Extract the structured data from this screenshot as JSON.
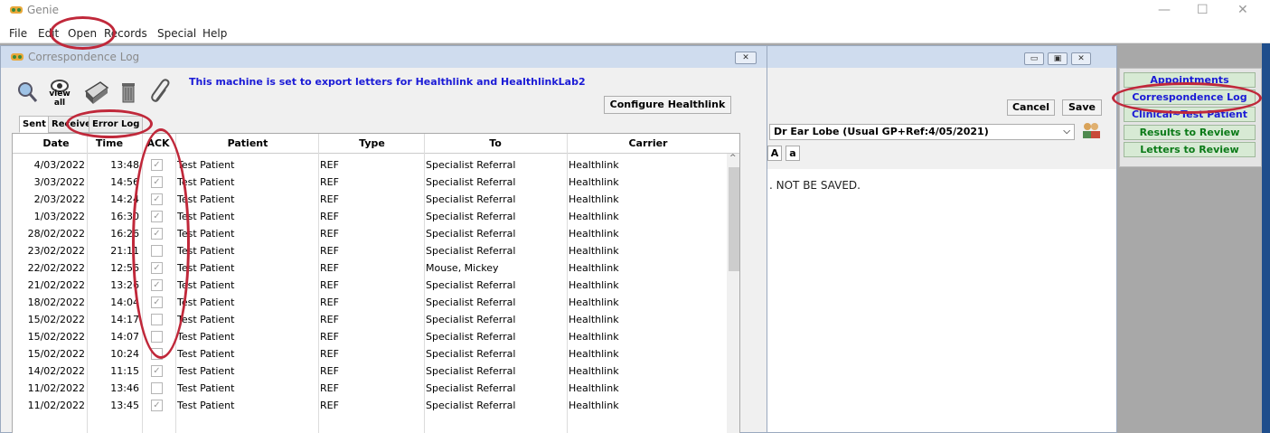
{
  "app": {
    "title": "Genie"
  },
  "menu": [
    "File",
    "Edit",
    "Open",
    "Records",
    "Special",
    "Help"
  ],
  "right_panel": {
    "buttons": [
      {
        "label": "Appointments",
        "color": "#1a1ad6"
      },
      {
        "label": "Correspondence Log",
        "color": "#1a1ad6"
      },
      {
        "label": "Clinical~Test Patient",
        "color": "#1a1ad6"
      },
      {
        "label": "Results to Review",
        "color": "#0b7a18"
      },
      {
        "label": "Letters to Review",
        "color": "#0b7a18"
      }
    ]
  },
  "back_window": {
    "cancel_label": "Cancel",
    "save_label": "Save",
    "doctor_combo_value": "Dr Ear Lobe (Usual GP+Ref:4/05/2021)",
    "text_buttons": [
      "A",
      "a"
    ],
    "warning_text": ". NOT BE SAVED."
  },
  "correspondence_log": {
    "title": "Correspondence Log",
    "toolbar": {
      "view_all_label": "view all"
    },
    "export_message": "This machine is set to export letters for Healthlink and HealthlinkLab2",
    "configure_button": "Configure Healthlink",
    "tabs": [
      "Sent",
      "Received",
      "Error Log"
    ],
    "columns": [
      "Date",
      "Time",
      "ACK",
      "Patient",
      "Type",
      "To",
      "Carrier"
    ],
    "rows": [
      {
        "date": "4/03/2022",
        "time": "13:48",
        "ack": true,
        "patient": "Test Patient",
        "type": "REF",
        "to": "Specialist Referral",
        "carrier": "Healthlink"
      },
      {
        "date": "3/03/2022",
        "time": "14:56",
        "ack": true,
        "patient": "Test Patient",
        "type": "REF",
        "to": "Specialist Referral",
        "carrier": "Healthlink"
      },
      {
        "date": "2/03/2022",
        "time": "14:24",
        "ack": true,
        "patient": "Test Patient",
        "type": "REF",
        "to": "Specialist Referral",
        "carrier": "Healthlink"
      },
      {
        "date": "1/03/2022",
        "time": "16:30",
        "ack": true,
        "patient": "Test Patient",
        "type": "REF",
        "to": "Specialist Referral",
        "carrier": "Healthlink"
      },
      {
        "date": "28/02/2022",
        "time": "16:26",
        "ack": true,
        "patient": "Test Patient",
        "type": "REF",
        "to": "Specialist Referral",
        "carrier": "Healthlink"
      },
      {
        "date": "23/02/2022",
        "time": "21:11",
        "ack": false,
        "patient": "Test Patient",
        "type": "REF",
        "to": "Specialist Referral",
        "carrier": "Healthlink"
      },
      {
        "date": "22/02/2022",
        "time": "12:56",
        "ack": true,
        "patient": "Test Patient",
        "type": "REF",
        "to": "Mouse, Mickey",
        "carrier": "Healthlink"
      },
      {
        "date": "21/02/2022",
        "time": "13:26",
        "ack": true,
        "patient": "Test Patient",
        "type": "REF",
        "to": "Specialist Referral",
        "carrier": "Healthlink"
      },
      {
        "date": "18/02/2022",
        "time": "14:04",
        "ack": true,
        "patient": "Test Patient",
        "type": "REF",
        "to": "Specialist Referral",
        "carrier": "Healthlink"
      },
      {
        "date": "15/02/2022",
        "time": "14:17",
        "ack": false,
        "patient": "Test Patient",
        "type": "REF",
        "to": "Specialist Referral",
        "carrier": "Healthlink"
      },
      {
        "date": "15/02/2022",
        "time": "14:07",
        "ack": false,
        "patient": "Test Patient",
        "type": "REF",
        "to": "Specialist Referral",
        "carrier": "Healthlink"
      },
      {
        "date": "15/02/2022",
        "time": "10:24",
        "ack": false,
        "patient": "Test Patient",
        "type": "REF",
        "to": "Specialist Referral",
        "carrier": "Healthlink"
      },
      {
        "date": "14/02/2022",
        "time": "11:15",
        "ack": true,
        "patient": "Test Patient",
        "type": "REF",
        "to": "Specialist Referral",
        "carrier": "Healthlink"
      },
      {
        "date": "11/02/2022",
        "time": "13:46",
        "ack": false,
        "patient": "Test Patient",
        "type": "REF",
        "to": "Specialist Referral",
        "carrier": "Healthlink"
      },
      {
        "date": "11/02/2022",
        "time": "13:45",
        "ack": true,
        "patient": "Test Patient",
        "type": "REF",
        "to": "Specialist Referral",
        "carrier": "Healthlink"
      }
    ]
  },
  "colors": {
    "annotation": "#c0283a",
    "link_blue": "#1a1ad6",
    "green": "#0b7a18"
  }
}
